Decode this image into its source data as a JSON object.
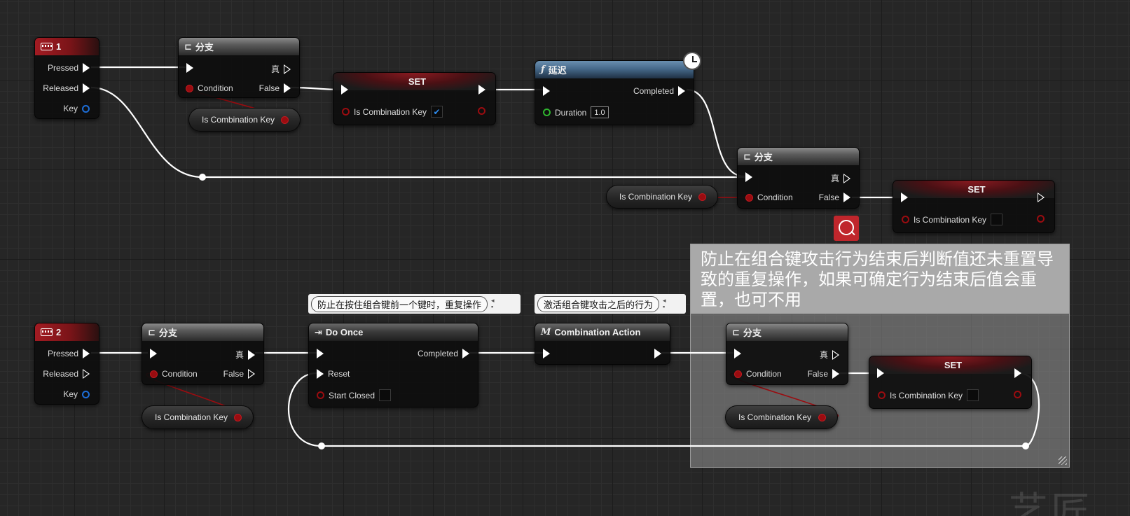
{
  "nodes": {
    "key1": {
      "title": "1",
      "pressed": "Pressed",
      "released": "Released",
      "key": "Key"
    },
    "branch1": {
      "title": "分支",
      "true_label": "真",
      "condition": "Condition",
      "false_label": "False"
    },
    "get1": {
      "label": "Is Combination Key"
    },
    "set1": {
      "title": "SET",
      "var": "Is Combination Key",
      "checked": true,
      "check_mark": "✔"
    },
    "delay": {
      "title": "延迟",
      "completed": "Completed",
      "duration_label": "Duration",
      "duration_value": "1.0"
    },
    "branch2": {
      "title": "分支",
      "true_label": "真",
      "condition": "Condition",
      "false_label": "False"
    },
    "get2": {
      "label": "Is Combination Key"
    },
    "set2": {
      "title": "SET",
      "var": "Is Combination Key",
      "checked": false
    },
    "key2": {
      "title": "2",
      "pressed": "Pressed",
      "released": "Released",
      "key": "Key"
    },
    "branch3": {
      "title": "分支",
      "true_label": "真",
      "condition": "Condition",
      "false_label": "False"
    },
    "get3": {
      "label": "Is Combination Key"
    },
    "doonce": {
      "title": "Do Once",
      "completed": "Completed",
      "reset": "Reset",
      "start_closed": "Start Closed"
    },
    "combo": {
      "title": "Combination Action",
      "icon": "M"
    },
    "branch4": {
      "title": "分支",
      "true_label": "真",
      "condition": "Condition",
      "false_label": "False"
    },
    "get4": {
      "label": "Is Combination Key"
    },
    "set3": {
      "title": "SET",
      "var": "Is Combination Key",
      "checked": false
    }
  },
  "comments": {
    "doonce_bubble": "防止在按住组合键前一个键时，重复操作",
    "combo_bubble": "激活组合键攻击之后的行为",
    "box_title": "防止在组合键攻击行为结束后判断值还未重置导致的重复操作，如果可确定行为结束后值会重置，也可不用"
  },
  "watermark": "艺匠",
  "colors": {
    "exec_wire": "#ffffff",
    "bool_wire": "#9a0c10",
    "event_header": "#a31b22",
    "function_header": "#46698a",
    "comment_box": "#a9a9a9"
  }
}
